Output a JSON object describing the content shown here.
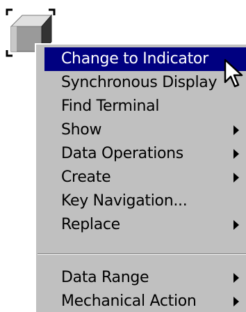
{
  "control": {
    "icon": "boolean-button-icon"
  },
  "context_menu": {
    "items": [
      {
        "label": "Change to Indicator",
        "submenu": false,
        "highlighted": true
      },
      {
        "label": "Synchronous Display",
        "submenu": false,
        "highlighted": false
      },
      {
        "label": "Find Terminal",
        "submenu": false,
        "highlighted": false
      },
      {
        "label": "Show",
        "submenu": true,
        "highlighted": false
      },
      {
        "label": "Data Operations",
        "submenu": true,
        "highlighted": false
      },
      {
        "label": "Create",
        "submenu": true,
        "highlighted": false
      },
      {
        "label": "Key Navigation...",
        "submenu": false,
        "highlighted": false
      },
      {
        "label": "Replace",
        "submenu": true,
        "highlighted": false
      },
      {
        "label": "Data Range",
        "submenu": true,
        "highlighted": false
      },
      {
        "label": "Mechanical Action",
        "submenu": true,
        "highlighted": false
      }
    ]
  },
  "colors": {
    "menu_background": "#c0c0c0",
    "highlight": "#000080",
    "highlight_text": "#ffffff",
    "text": "#000000"
  },
  "cursor": {
    "icon": "arrow-cursor-icon"
  }
}
